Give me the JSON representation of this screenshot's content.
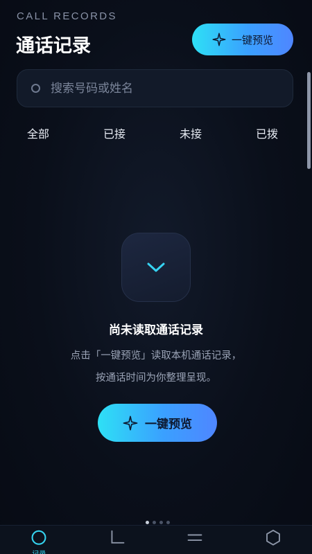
{
  "header": {
    "kicker": "CALL RECORDS",
    "title": "通话记录",
    "preview_button": "一键预览"
  },
  "search": {
    "placeholder": "搜索号码或姓名"
  },
  "tabs": [
    "全部",
    "已接",
    "未接",
    "已拨"
  ],
  "empty_state": {
    "title": "尚未读取通话记录",
    "line1": "点击「一键预览」读取本机通话记录，",
    "line2": "按通话时间为你整理呈现。",
    "cta": "一键预览"
  },
  "bottom_nav": {
    "items": [
      {
        "label": "记录",
        "icon": "circle-icon"
      },
      {
        "label": "",
        "icon": "corner-icon"
      },
      {
        "label": "",
        "icon": "menu-lines-icon"
      },
      {
        "label": "",
        "icon": "hexagon-icon"
      }
    ]
  },
  "colors": {
    "accent_start": "#2ee0f5",
    "accent_end": "#4f86ff",
    "background": "#0a0f1a"
  }
}
